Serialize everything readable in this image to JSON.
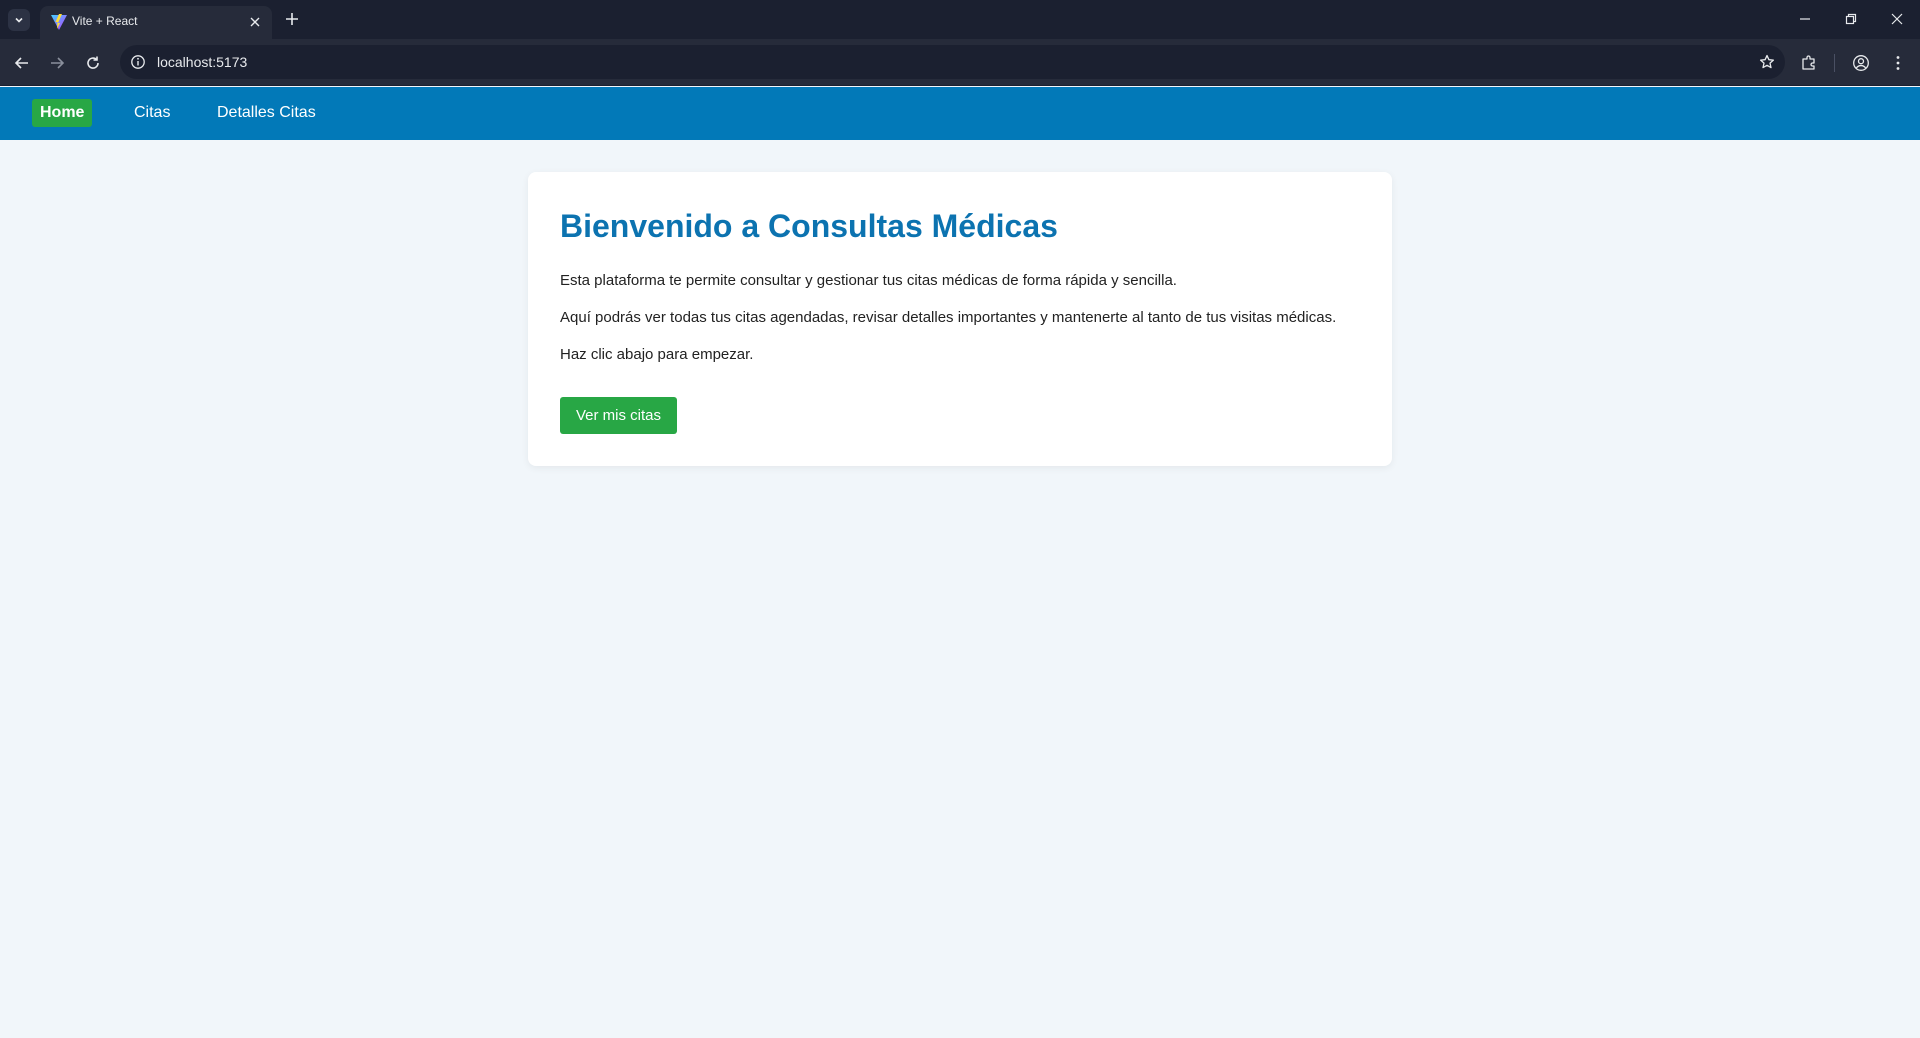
{
  "browser": {
    "tab_title": "Vite + React",
    "url": "localhost:5173"
  },
  "icons": {
    "tab_list": "chevron-down-icon",
    "favicon": "vite-logo-icon",
    "tab_close": "close-icon",
    "new_tab": "plus-icon",
    "minimize": "minimize-icon",
    "restore": "restore-icon",
    "close_window": "close-icon",
    "back": "arrow-left-icon",
    "forward": "arrow-right-icon",
    "reload": "reload-icon",
    "site_info": "info-circle-icon",
    "bookmark": "star-icon",
    "extensions": "puzzle-icon",
    "profile": "profile-icon",
    "menu": "kebab-menu-icon"
  },
  "nav": {
    "items": [
      {
        "label": "Home",
        "active": true
      },
      {
        "label": "Citas",
        "active": false
      },
      {
        "label": "Detalles Citas",
        "active": false
      }
    ]
  },
  "main": {
    "title": "Bienvenido a Consultas Médicas",
    "paragraphs": [
      "Esta plataforma te permite consultar y gestionar tus citas médicas de forma rápida y sencilla.",
      "Aquí podrás ver todas tus citas agendadas, revisar detalles importantes y mantenerte al tanto de tus visitas médicas.",
      "Haz clic abajo para empezar."
    ],
    "cta_label": "Ver mis citas"
  },
  "colors": {
    "navbar": "#0279b8",
    "accent_green": "#28a745",
    "title_blue": "#0c73b0",
    "page_bg": "#f1f6fa"
  }
}
